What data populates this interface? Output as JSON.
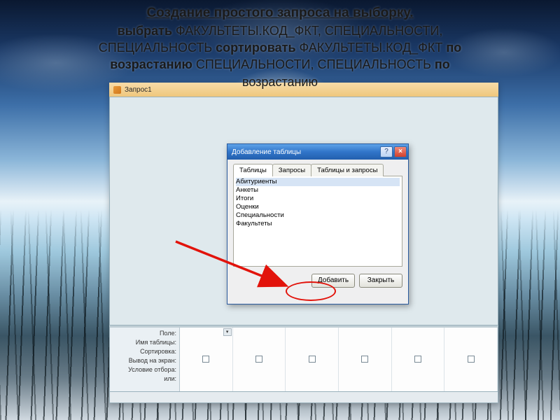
{
  "slide": {
    "title": "Создание простого запроса на выборку.",
    "line1_a": "выбрать",
    "line1_b": " ФАКУЛЬТЕТЫ.КОД_ФКТ, СПЕЦИАЛЬНОСТИ,",
    "line2_a": "СПЕЦИАЛЬНОСТЬ ",
    "line2_b": "сортировать",
    "line2_c": " ФАКУЛЬТЕТЫ.КОД_ФКТ ",
    "line2_d": "по",
    "line3_a": "возрастанию",
    "line3_b": " СПЕЦИАЛЬНОСТИ, СПЕЦИАЛЬНОСТЬ ",
    "line3_c": "по",
    "line4": "возрастанию"
  },
  "window": {
    "tab": "Запрос1"
  },
  "dialog": {
    "title": "Добавление таблицы",
    "help_char": "?",
    "close_char": "×",
    "tabs": {
      "t1": "Таблицы",
      "t2": "Запросы",
      "t3": "Таблицы и запросы"
    },
    "items": [
      "Абитуриенты",
      "Анкеты",
      "Итоги",
      "Оценки",
      "Специальности",
      "Факультеты"
    ],
    "add": "Добавить",
    "close": "Закрыть"
  },
  "grid": {
    "field": "Поле:",
    "table": "Имя таблицы:",
    "sort": "Сортировка:",
    "show": "Вывод на экран:",
    "criteria": "Условие отбора:",
    "or": "или:"
  }
}
